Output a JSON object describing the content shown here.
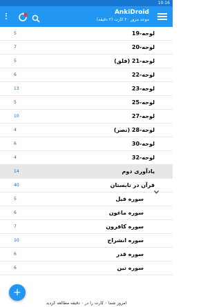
{
  "status_bar": {
    "time": "10:16"
  },
  "app_bar": {
    "title": "AnkiDroid",
    "subtitle": "موعد مرور ۲۰ کارت (۲ دقیقه)",
    "sync_badge": "!"
  },
  "decks": [
    {
      "name": "لوحه-19",
      "new": "5",
      "learn": "",
      "due": ""
    },
    {
      "name": "لوحه-20",
      "new": "7",
      "learn": "",
      "due": ""
    },
    {
      "name": "لوحه-21 (فلق)",
      "new": "5",
      "learn": "",
      "due": ""
    },
    {
      "name": "لوحه-22",
      "new": "6",
      "learn": "",
      "due": ""
    },
    {
      "name": "لوحه-23",
      "new": "13",
      "learn": "",
      "due": ""
    },
    {
      "name": "لوحه-25",
      "new": "5",
      "learn": "",
      "due": ""
    },
    {
      "name": "لوحه-27",
      "new": "10",
      "learn": "",
      "due": ""
    },
    {
      "name": "لوحه-28 (نصر)",
      "new": "4",
      "learn": "",
      "due": ""
    },
    {
      "name": "لوحه-30",
      "new": "6",
      "learn": "",
      "due": ""
    },
    {
      "name": "لوحه-32",
      "new": "4",
      "learn": "",
      "due": ""
    },
    {
      "name": "یادآوری دوم",
      "new": "14",
      "learn": "",
      "due": "",
      "selected": true
    },
    {
      "name": "قرآن در تابستان",
      "new": "40",
      "learn": "",
      "due": "",
      "expandable": true
    },
    {
      "name": "سوره فیل",
      "new": "5",
      "learn": "",
      "due": "",
      "sub": true
    },
    {
      "name": "سوره ماعون",
      "new": "6",
      "learn": "",
      "due": "",
      "sub": true
    },
    {
      "name": "سوره کافرون",
      "new": "7",
      "learn": "",
      "due": "",
      "sub": true
    },
    {
      "name": "سوره انشراح",
      "new": "10",
      "learn": "",
      "due": "",
      "sub": true
    },
    {
      "name": "سوره قدر",
      "new": "6",
      "learn": "",
      "due": "",
      "sub": true
    },
    {
      "name": "سوره تین",
      "new": "6",
      "learn": "",
      "due": "",
      "sub": true
    }
  ],
  "fab": {
    "label": "+"
  },
  "footer": {
    "text": "امروز شما ۰ کارت را در ۰ دقیقه مطالعه کردید"
  }
}
